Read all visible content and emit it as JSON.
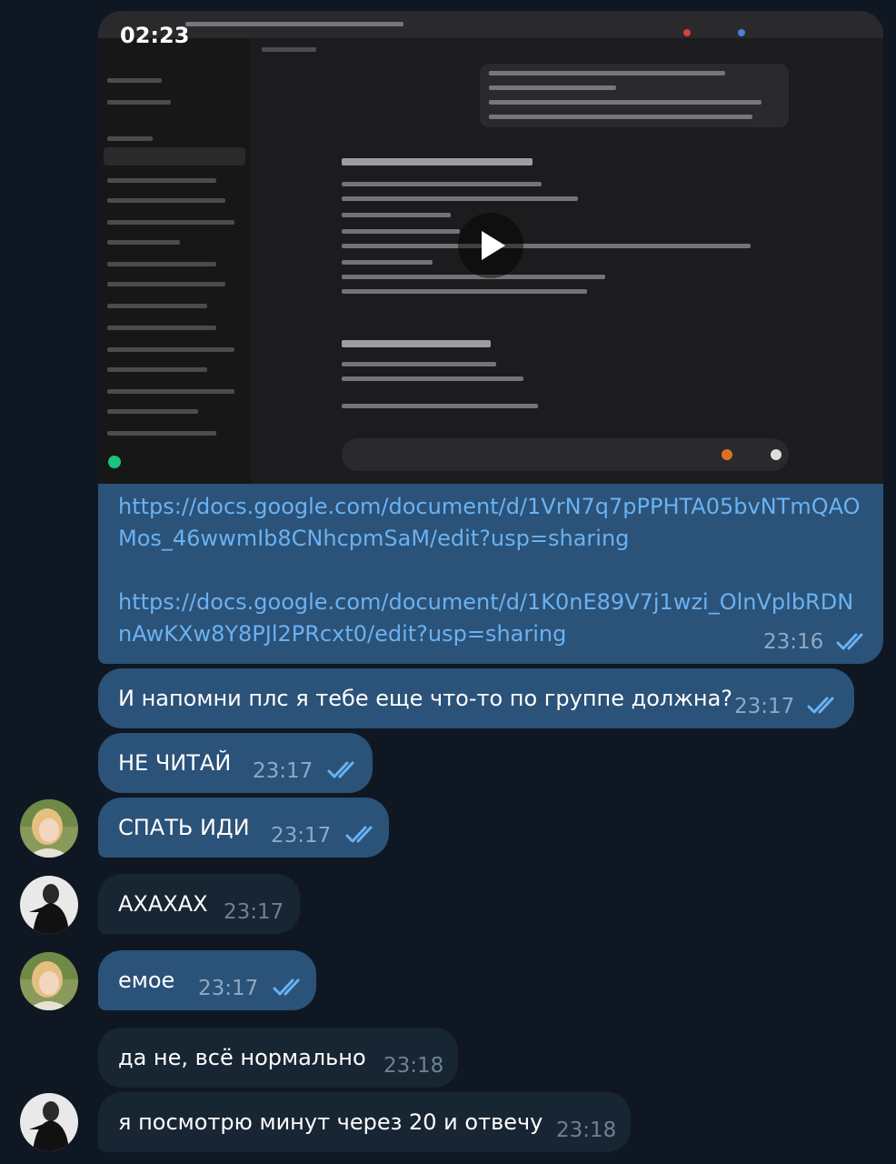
{
  "video": {
    "duration": "02:23"
  },
  "links": [
    {
      "line1": "https://docs.google.com/document/d/1VrN7q7pPPHTA05bvNTmQAO",
      "line2": "Mos_46wwmIb8CNhcpmSaM/edit?usp=sharing"
    },
    {
      "line1": "https://docs.google.com/document/d/1K0nE89V7j1wzi_OlnVplbRDN",
      "line2": "nAwKXw8Y8PJl2PRcxt0/edit?usp=sharing"
    }
  ],
  "media_message_time": "23:16",
  "messages": [
    {
      "text": "И напомни плс я тебе еще что-то по группе должна?",
      "time": "23:17",
      "direction": "out"
    },
    {
      "text": "НЕ ЧИТАЙ",
      "time": "23:17",
      "direction": "out"
    },
    {
      "text": "СПАТЬ ИДИ",
      "time": "23:17",
      "direction": "out"
    },
    {
      "text": "АХАХАХ",
      "time": "23:17",
      "direction": "in"
    },
    {
      "text": "емое",
      "time": "23:17",
      "direction": "out"
    },
    {
      "text": "да не, всё нормально",
      "time": "23:18",
      "direction": "in"
    },
    {
      "text": "я посмотрю минут через 20 и отвечу",
      "time": "23:18",
      "direction": "in"
    }
  ],
  "colors": {
    "background": "#0f1723",
    "outgoing_bubble": "#2b5278",
    "incoming_bubble": "#182533",
    "link": "#6ab2f2",
    "read_ticks": "#6ab2f2"
  },
  "icons": [
    "play-icon",
    "double-check-icon"
  ]
}
